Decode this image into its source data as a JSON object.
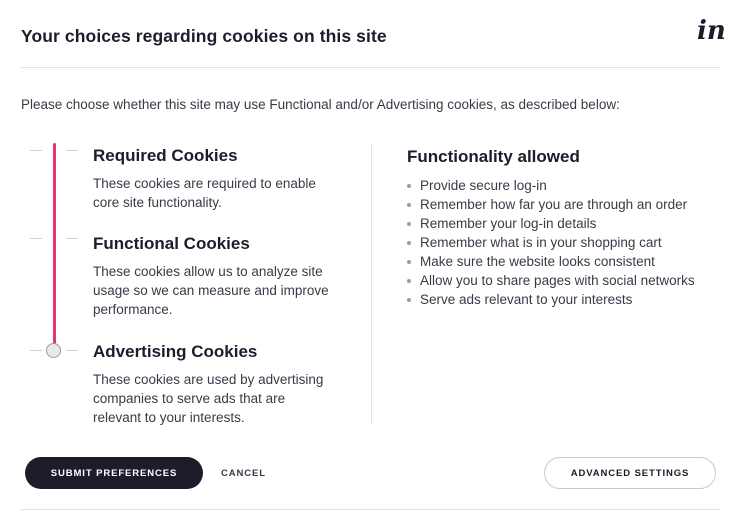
{
  "header": {
    "title": "Your choices regarding cookies on this site",
    "logo_text": "in",
    "logo_icon": "invision-logo-icon"
  },
  "intro": "Please choose whether this site may use Functional and/or Advertising cookies, as described below:",
  "levels": [
    {
      "title": "Required Cookies",
      "description": "These cookies are required to enable core site functionality."
    },
    {
      "title": "Functional Cookies",
      "description": "These cookies allow us to analyze site usage so we can measure and improve performance."
    },
    {
      "title": "Advertising Cookies",
      "description": "These cookies are used by advertising companies to serve ads that are relevant to your interests."
    }
  ],
  "slider": {
    "selected_level": "Advertising Cookies",
    "accent_color": "#e8366b"
  },
  "allowed": {
    "title": "Functionality allowed",
    "items": [
      "Provide secure log-in",
      "Remember how far you are through an order",
      "Remember your log-in details",
      "Remember what is in your shopping cart",
      "Make sure the website looks consistent",
      "Allow you to share pages with social networks",
      "Serve ads relevant to your interests"
    ]
  },
  "buttons": {
    "submit": "SUBMIT PREFERENCES",
    "cancel": "CANCEL",
    "advanced": "ADVANCED SETTINGS"
  }
}
